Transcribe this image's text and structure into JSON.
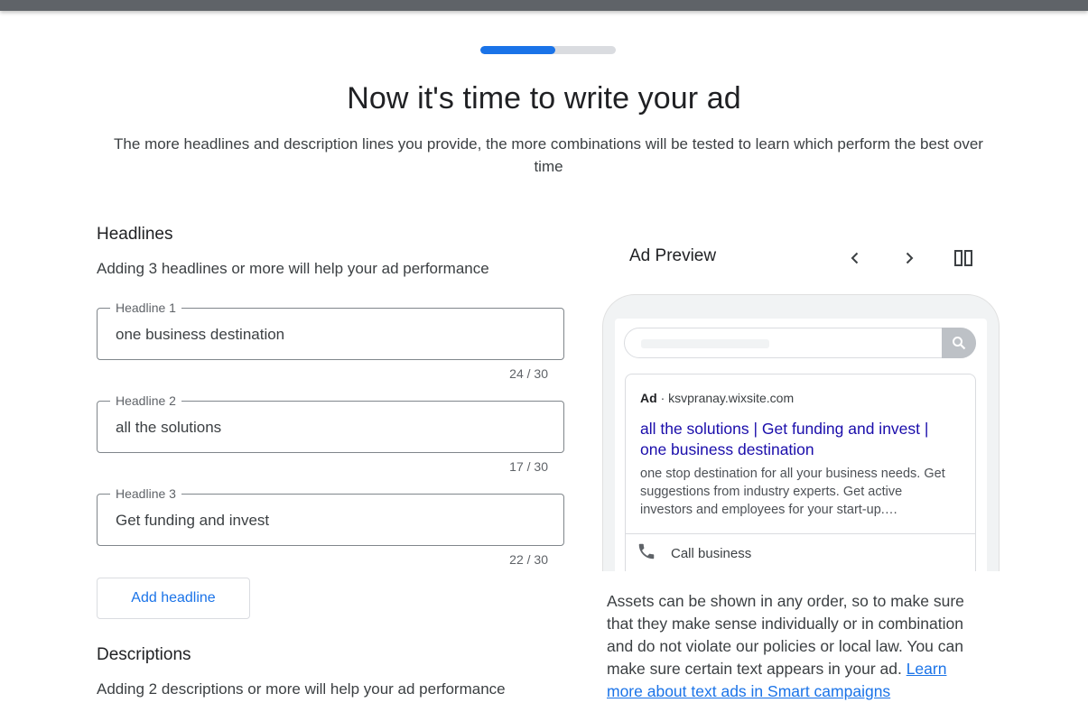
{
  "progress": {
    "value": 0.55
  },
  "header": {
    "title": "Now it's time to write your ad",
    "subtitle": "The more headlines and description lines you provide, the more combinations will be tested to learn which perform the best over time"
  },
  "headlines": {
    "title": "Headlines",
    "hint": "Adding 3 headlines or more will help your ad performance",
    "fields": [
      {
        "label": "Headline 1",
        "value": "one business destination",
        "counter": "24 / 30"
      },
      {
        "label": "Headline 2",
        "value": "all the solutions",
        "counter": "17 / 30"
      },
      {
        "label": "Headline 3",
        "value": "Get funding and invest",
        "counter": "22 / 30"
      }
    ],
    "add_button": "Add headline"
  },
  "descriptions": {
    "title": "Descriptions",
    "hint": "Adding 2 descriptions or more will help your ad performance"
  },
  "preview": {
    "title": "Ad Preview",
    "icons": {
      "prev": "chevron-left-icon",
      "next": "chevron-right-icon",
      "layout": "split-view-icon",
      "search": "search-icon",
      "call": "phone-icon"
    },
    "ad": {
      "label": "Ad",
      "separator": "·",
      "domain": "ksvpranay.wixsite.com",
      "headline": "all the solutions | Get funding and invest | one business destination",
      "description": "one stop destination for all your business needs. Get suggestions from industry experts. Get active investors and employees for your start-up.…",
      "call": "Call business"
    },
    "note_text": "Assets can be shown in any order, so to make sure that they make sense individually or in combination and do not violate our policies or local law. You can make sure certain text appears in your ad. ",
    "note_link": "Learn more about text ads in Smart campaigns"
  },
  "colors": {
    "accent": "#1a73e8",
    "ad_link": "#1a0dab",
    "topbar": "#5f6368"
  }
}
